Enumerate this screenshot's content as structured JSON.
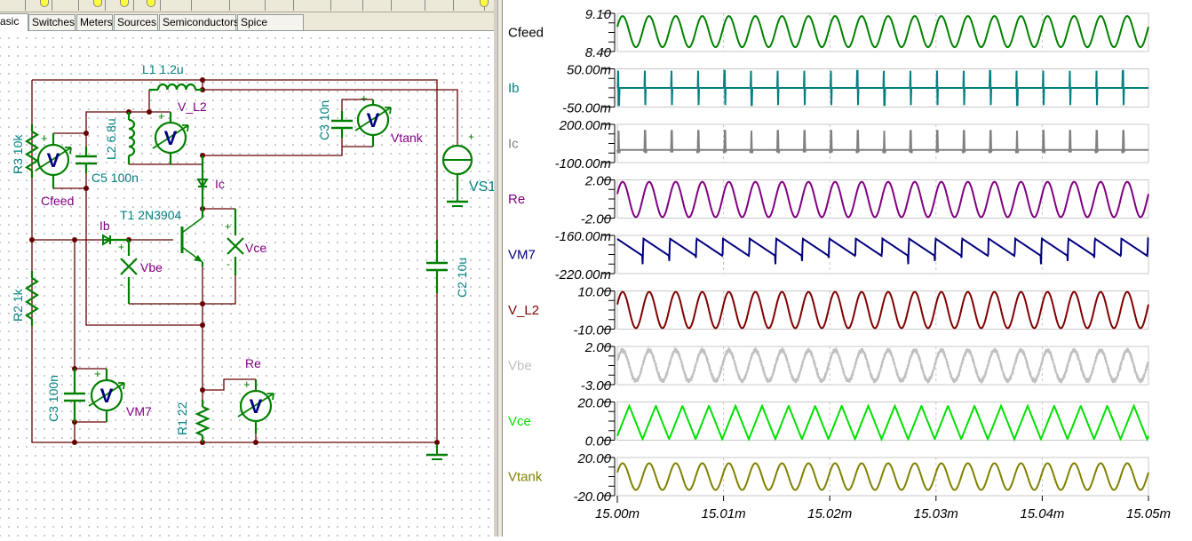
{
  "tabs": [
    {
      "label": "asic",
      "active": true
    },
    {
      "label": "Switches"
    },
    {
      "label": "Meters"
    },
    {
      "label": "Sources"
    },
    {
      "label": "Semiconductors"
    },
    {
      "label": "Spice Macros"
    }
  ],
  "schematic": {
    "labels": {
      "L1": "L1 1.2u",
      "R3": "R3 10k",
      "L2": "L2 6.8u",
      "C5": "C5 100n",
      "C3top": "C3 10n",
      "VS1": "VS1",
      "T1": "T1 2N3904",
      "R2": "R2 1k",
      "C2": "C2 10u",
      "C3bot": "C3 100n",
      "R1": "R1 22",
      "Cfeed": "Cfeed",
      "V_L2": "V_L2",
      "Vtank": "Vtank",
      "Ib": "Ib",
      "Ic": "Ic",
      "Vbe": "Vbe",
      "Vce": "Vce",
      "VM7": "VM7",
      "Re": "Re",
      "meter_symbol": "V",
      "plus": "+",
      "minus": "-"
    },
    "colors": {
      "wire": "#660000",
      "component": "#008000",
      "label_component": "#008080",
      "label_meter": "#800080",
      "meter_letter": "#000080"
    }
  },
  "chart_data": {
    "type": "line",
    "x_ticks": [
      "15.00m",
      "15.01m",
      "15.02m",
      "15.03m",
      "15.04m",
      "15.05m"
    ],
    "xlim": [
      0.015,
      0.01505
    ],
    "grid": true,
    "cycles_shown": 20,
    "series": [
      {
        "name": "Cfeed",
        "label_color": "#000000",
        "color": "#008000",
        "ylim_labels": [
          "9.10",
          "8.40"
        ],
        "ylim": [
          8.4,
          9.1
        ],
        "min": 8.48,
        "max": 9.05,
        "shape": "sine"
      },
      {
        "name": "Ib",
        "label_color": "#008080",
        "color": "#008080",
        "ylim_labels": [
          "50.00m",
          "-50.00m"
        ],
        "ylim": [
          -0.05,
          0.05
        ],
        "min": -0.045,
        "max": 0.045,
        "shape": "spike"
      },
      {
        "name": "Ic",
        "label_color": "#808080",
        "color": "#808080",
        "ylim_labels": [
          "200.00m",
          "-100.00m"
        ],
        "ylim": [
          -0.1,
          0.2
        ],
        "min": -0.02,
        "max": 0.15,
        "shape": "pulse"
      },
      {
        "name": "Re",
        "label_color": "#800080",
        "color": "#800080",
        "ylim_labels": [
          "2.00",
          "-2.00"
        ],
        "ylim": [
          -2,
          2
        ],
        "min": -1.9,
        "max": 1.8,
        "shape": "sine"
      },
      {
        "name": "VM7",
        "label_color": "#000080",
        "color": "#000080",
        "ylim_labels": [
          "-160.00m",
          "-220.00m"
        ],
        "ylim": [
          -0.22,
          -0.16
        ],
        "min": -0.21,
        "max": -0.165,
        "shape": "saw"
      },
      {
        "name": "V_L2",
        "label_color": "#800000",
        "color": "#800000",
        "ylim_labels": [
          "10.00",
          "-10.00"
        ],
        "ylim": [
          -10,
          10
        ],
        "min": -9.5,
        "max": 9.5,
        "shape": "sine"
      },
      {
        "name": "Vbe",
        "label_color": "#c0c0c0",
        "color": "#c0c0c0",
        "ylim_labels": [
          "2.00",
          "-3.00"
        ],
        "ylim": [
          -3,
          2
        ],
        "min": -2.5,
        "max": 1.5,
        "shape": "noisy-sine"
      },
      {
        "name": "Vce",
        "label_color": "#00e000",
        "color": "#00e000",
        "ylim_labels": [
          "20.00",
          "0.00"
        ],
        "ylim": [
          0,
          20
        ],
        "min": 0.5,
        "max": 18,
        "shape": "triangle"
      },
      {
        "name": "Vtank",
        "label_color": "#808000",
        "color": "#808000",
        "ylim_labels": [
          "20.00",
          "-20.00"
        ],
        "ylim": [
          -20,
          20
        ],
        "min": -14,
        "max": 14,
        "shape": "sine"
      }
    ]
  }
}
